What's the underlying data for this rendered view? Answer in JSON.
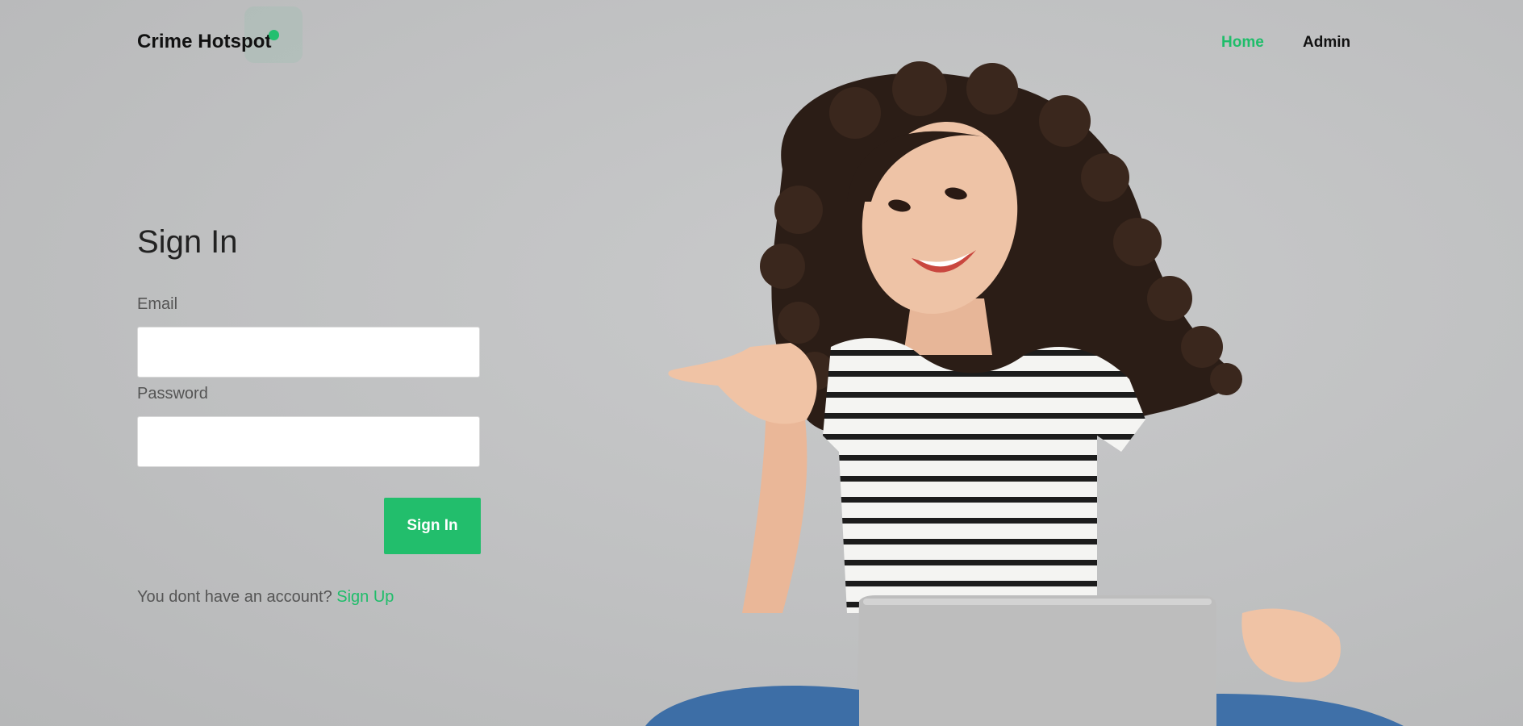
{
  "header": {
    "brand": "Crime Hotspot",
    "nav": {
      "home": "Home",
      "admin": "Admin"
    }
  },
  "form": {
    "title": "Sign In",
    "email_label": "Email",
    "email_value": "",
    "password_label": "Password",
    "password_value": "",
    "submit_label": "Sign In",
    "account_prompt": "You dont have an account?",
    "signup_label": "Sign Up"
  },
  "colors": {
    "accent": "#22be6c",
    "background": "#c4c5c6",
    "text_dark": "#111111",
    "text_muted": "#555555"
  },
  "hero": {
    "image": "woman-with-laptop-pointing-thumb-photo"
  }
}
